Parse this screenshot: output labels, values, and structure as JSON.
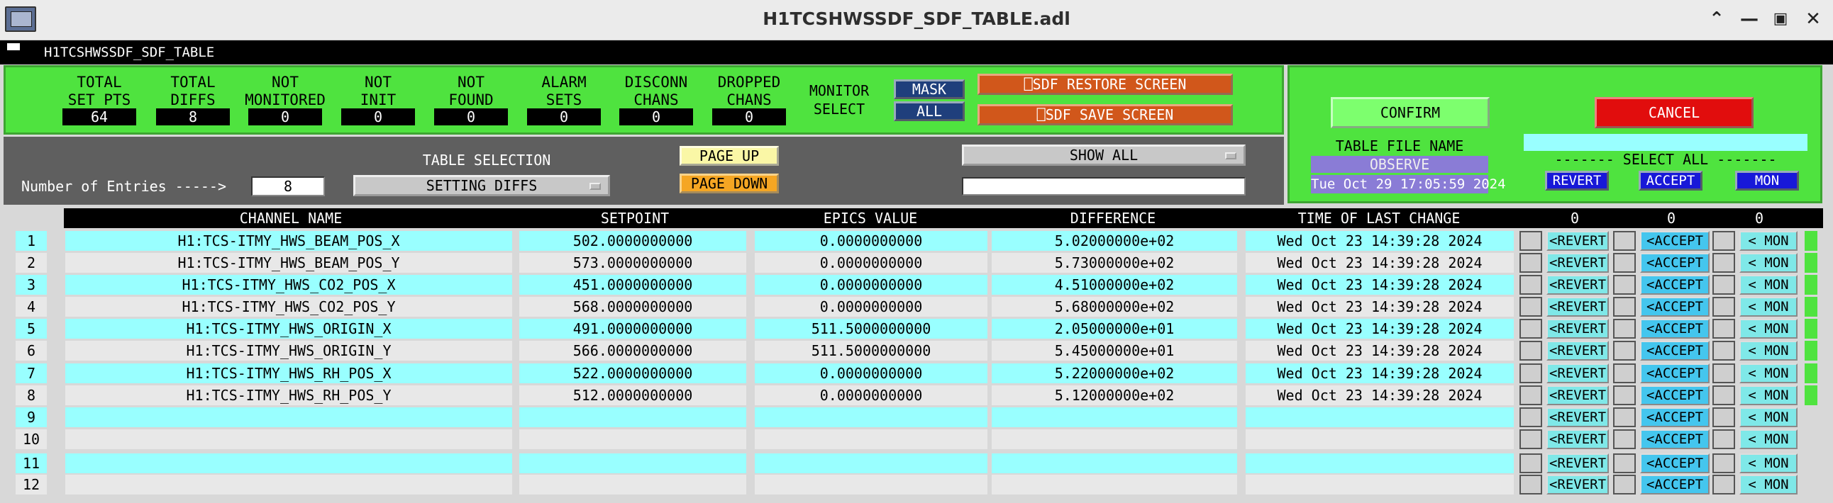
{
  "window": {
    "title": "H1TCSHWSSDF_SDF_TABLE.adl"
  },
  "header": {
    "label": "H1TCSHWSSDF_SDF_TABLE"
  },
  "stats": [
    {
      "label1": "TOTAL",
      "label2": "SET PTS",
      "value": "64"
    },
    {
      "label1": "TOTAL",
      "label2": "DIFFS",
      "value": "8"
    },
    {
      "label1": "NOT",
      "label2": "MONITORED",
      "value": "0"
    },
    {
      "label1": "NOT",
      "label2": "INIT",
      "value": "0"
    },
    {
      "label1": "NOT",
      "label2": "FOUND",
      "value": "0"
    },
    {
      "label1": "ALARM",
      "label2": "SETS",
      "value": "0"
    },
    {
      "label1": "DISCONN",
      "label2": "CHANS",
      "value": "0"
    },
    {
      "label1": "DROPPED",
      "label2": "CHANS",
      "value": "0"
    }
  ],
  "monitor": {
    "label1": "MONITOR",
    "label2": "SELECT",
    "mask": "MASK",
    "all": "ALL"
  },
  "screens": {
    "restore": "⎕SDF RESTORE SCREEN",
    "save": "⎕SDF SAVE SCREEN"
  },
  "controls": {
    "entries_label": "Number of Entries ----->",
    "entries_value": "8",
    "table_selection_label": "TABLE SELECTION",
    "table_selection_value": "SETTING DIFFS",
    "page_up": "PAGE UP",
    "page_down": "PAGE DOWN",
    "show_all": "SHOW ALL",
    "filter_value": ""
  },
  "right_panel": {
    "confirm": "CONFIRM",
    "cancel": "CANCEL",
    "table_file_label": "TABLE FILE NAME",
    "table_file_value": "OBSERVE",
    "timestamp": "Tue Oct 29 17:05:59 2024",
    "select_all_label": "------- SELECT ALL -------",
    "revert": "REVERT",
    "accept": "ACCEPT",
    "mon": "MON"
  },
  "table": {
    "headers": {
      "channel": "CHANNEL NAME",
      "setpoint": "SETPOINT",
      "epics": "EPICS VALUE",
      "difference": "DIFFERENCE",
      "time": "TIME OF LAST CHANGE",
      "count_revert": "0",
      "count_accept": "0",
      "count_mon": "0"
    },
    "row_buttons": {
      "revert": "<REVERT",
      "accept": "<ACCEPT",
      "mon": "< MON"
    },
    "rows": [
      {
        "n": "1",
        "channel": "H1:TCS-ITMY_HWS_BEAM_POS_X",
        "setpoint": "502.0000000000",
        "epics": "0.0000000000",
        "difference": "5.02000000e+02",
        "time": "Wed Oct 23 14:39:28 2024"
      },
      {
        "n": "2",
        "channel": "H1:TCS-ITMY_HWS_BEAM_POS_Y",
        "setpoint": "573.0000000000",
        "epics": "0.0000000000",
        "difference": "5.73000000e+02",
        "time": "Wed Oct 23 14:39:28 2024"
      },
      {
        "n": "3",
        "channel": "H1:TCS-ITMY_HWS_CO2_POS_X",
        "setpoint": "451.0000000000",
        "epics": "0.0000000000",
        "difference": "4.51000000e+02",
        "time": "Wed Oct 23 14:39:28 2024"
      },
      {
        "n": "4",
        "channel": "H1:TCS-ITMY_HWS_CO2_POS_Y",
        "setpoint": "568.0000000000",
        "epics": "0.0000000000",
        "difference": "5.68000000e+02",
        "time": "Wed Oct 23 14:39:28 2024"
      },
      {
        "n": "5",
        "channel": "H1:TCS-ITMY_HWS_ORIGIN_X",
        "setpoint": "491.0000000000",
        "epics": "511.5000000000",
        "difference": "2.05000000e+01",
        "time": "Wed Oct 23 14:39:28 2024"
      },
      {
        "n": "6",
        "channel": "H1:TCS-ITMY_HWS_ORIGIN_Y",
        "setpoint": "566.0000000000",
        "epics": "511.5000000000",
        "difference": "5.45000000e+01",
        "time": "Wed Oct 23 14:39:28 2024"
      },
      {
        "n": "7",
        "channel": "H1:TCS-ITMY_HWS_RH_POS_X",
        "setpoint": "522.0000000000",
        "epics": "0.0000000000",
        "difference": "5.22000000e+02",
        "time": "Wed Oct 23 14:39:28 2024"
      },
      {
        "n": "8",
        "channel": "H1:TCS-ITMY_HWS_RH_POS_Y",
        "setpoint": "512.0000000000",
        "epics": "0.0000000000",
        "difference": "5.12000000e+02",
        "time": "Wed Oct 23 14:39:28 2024"
      },
      {
        "n": "9",
        "channel": "",
        "setpoint": "",
        "epics": "",
        "difference": "",
        "time": ""
      },
      {
        "n": "10",
        "channel": "",
        "setpoint": "",
        "epics": "",
        "difference": "",
        "time": ""
      },
      {
        "n": "11",
        "channel": "",
        "setpoint": "",
        "epics": "",
        "difference": "",
        "time": ""
      },
      {
        "n": "12",
        "channel": "",
        "setpoint": "",
        "epics": "",
        "difference": "",
        "time": ""
      }
    ]
  },
  "colors": {
    "green_panel": "#4fe33f",
    "row_cyan": "#99ffff",
    "row_gray": "#e8e8e8"
  }
}
